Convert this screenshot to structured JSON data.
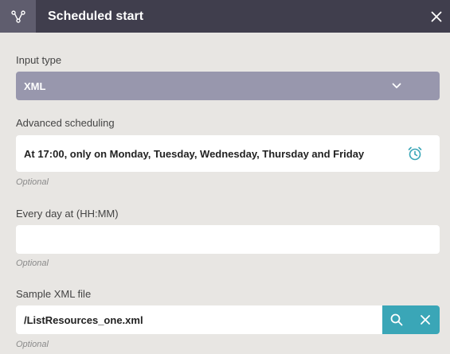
{
  "header": {
    "title": "Scheduled start",
    "icon": "workflow-node-icon",
    "close_icon": "close-icon"
  },
  "input_type": {
    "label": "Input type",
    "value": "XML"
  },
  "advanced_scheduling": {
    "label": "Advanced scheduling",
    "value": "At 17:00, only on Monday, Tuesday, Wednesday, Thursday and Friday",
    "hint": "Optional",
    "icon": "alarm-clock-icon"
  },
  "every_day": {
    "label": "Every day at (HH:MM)",
    "value": "",
    "hint": "Optional"
  },
  "sample_file": {
    "label": "Sample XML file",
    "value": "/ListResources_one.xml",
    "hint": "Optional",
    "search_icon": "search-icon",
    "clear_icon": "clear-icon"
  },
  "colors": {
    "header_bg": "#403e4d",
    "select_bg": "#9897ad",
    "accent": "#3aa6b7"
  }
}
